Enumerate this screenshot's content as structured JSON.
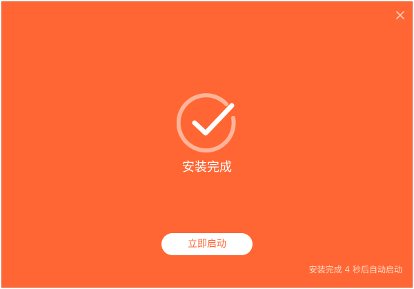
{
  "colors": {
    "background": "#ff6633",
    "accent": "#ff6633",
    "button_bg": "#ffffff",
    "countdown_text": "#ffd9c8"
  },
  "window": {
    "close_icon": "close-icon"
  },
  "status": {
    "icon": "check-circle-icon",
    "title": "安装完成"
  },
  "actions": {
    "launch_label": "立即启动"
  },
  "countdown": {
    "prefix": "安装完成",
    "seconds": "4",
    "suffix": "秒后自动启动"
  }
}
